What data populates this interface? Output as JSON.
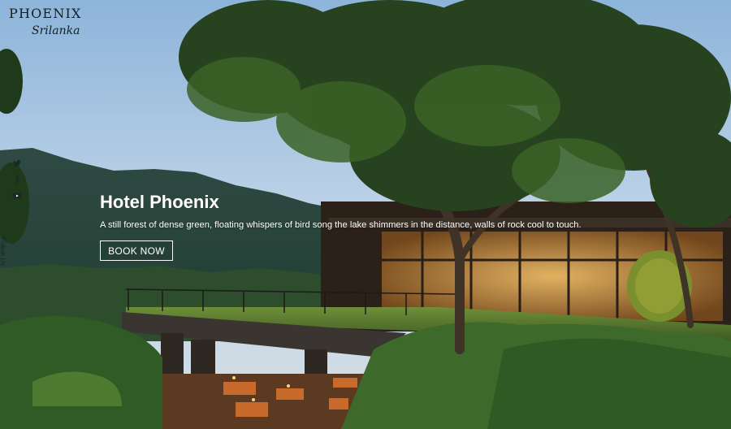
{
  "brand": {
    "wordmark": "PHOENIX",
    "tagline": "Srilanka"
  },
  "social": {
    "icons": [
      "twitter-icon",
      "facebook-icon",
      "youtube-icon"
    ],
    "follow_label": "Follow Us"
  },
  "hero": {
    "title": "Hotel Phoenix",
    "description": "A still forest of dense green, floating whispers of bird song the lake shimmers in the distance, walls of rock cool to touch.",
    "cta_label": "BOOK NOW"
  },
  "colors": {
    "text_light": "#ffffff",
    "logo_dark": "#14201f"
  }
}
